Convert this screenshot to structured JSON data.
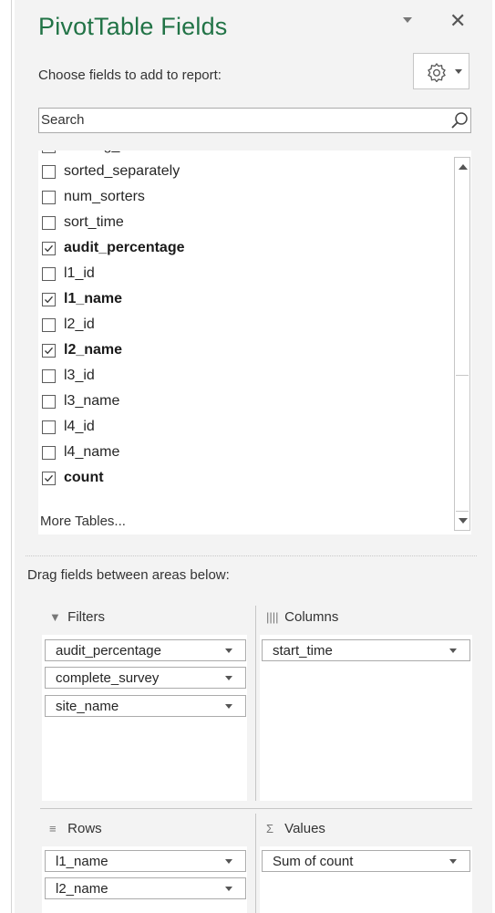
{
  "pane": {
    "title": "PivotTable Fields",
    "close_glyph": "✕",
    "choose_label": "Choose fields to add to report:",
    "gear_icon": "gear-icon"
  },
  "search": {
    "placeholder": "Search",
    "icon": "search-icon"
  },
  "fields": [
    {
      "label": "training_level",
      "checked": false,
      "bold": false
    },
    {
      "label": "sorted_separately",
      "checked": false,
      "bold": false
    },
    {
      "label": "num_sorters",
      "checked": false,
      "bold": false
    },
    {
      "label": "sort_time",
      "checked": false,
      "bold": false
    },
    {
      "label": "audit_percentage",
      "checked": true,
      "bold": true
    },
    {
      "label": "l1_id",
      "checked": false,
      "bold": false
    },
    {
      "label": "l1_name",
      "checked": true,
      "bold": true
    },
    {
      "label": "l2_id",
      "checked": false,
      "bold": false
    },
    {
      "label": "l2_name",
      "checked": true,
      "bold": true
    },
    {
      "label": "l3_id",
      "checked": false,
      "bold": false
    },
    {
      "label": "l3_name",
      "checked": false,
      "bold": false
    },
    {
      "label": "l4_id",
      "checked": false,
      "bold": false
    },
    {
      "label": "l4_name",
      "checked": false,
      "bold": false
    },
    {
      "label": "count",
      "checked": true,
      "bold": true
    }
  ],
  "more_tables": "More Tables...",
  "drag_label": "Drag fields between areas below:",
  "areas": {
    "filters": {
      "title": "Filters",
      "icon": "filter-icon",
      "items": [
        "audit_percentage",
        "complete_survey",
        "site_name"
      ]
    },
    "columns": {
      "title": "Columns",
      "icon": "columns-icon",
      "items": [
        "start_time"
      ]
    },
    "rows": {
      "title": "Rows",
      "icon": "rows-icon",
      "items": [
        "l1_name",
        "l2_name"
      ]
    },
    "values": {
      "title": "Values",
      "icon": "sigma-icon",
      "items": [
        "Sum of count"
      ]
    }
  },
  "colors": {
    "title": "#217346",
    "pane_bg": "#f3f3f3"
  }
}
